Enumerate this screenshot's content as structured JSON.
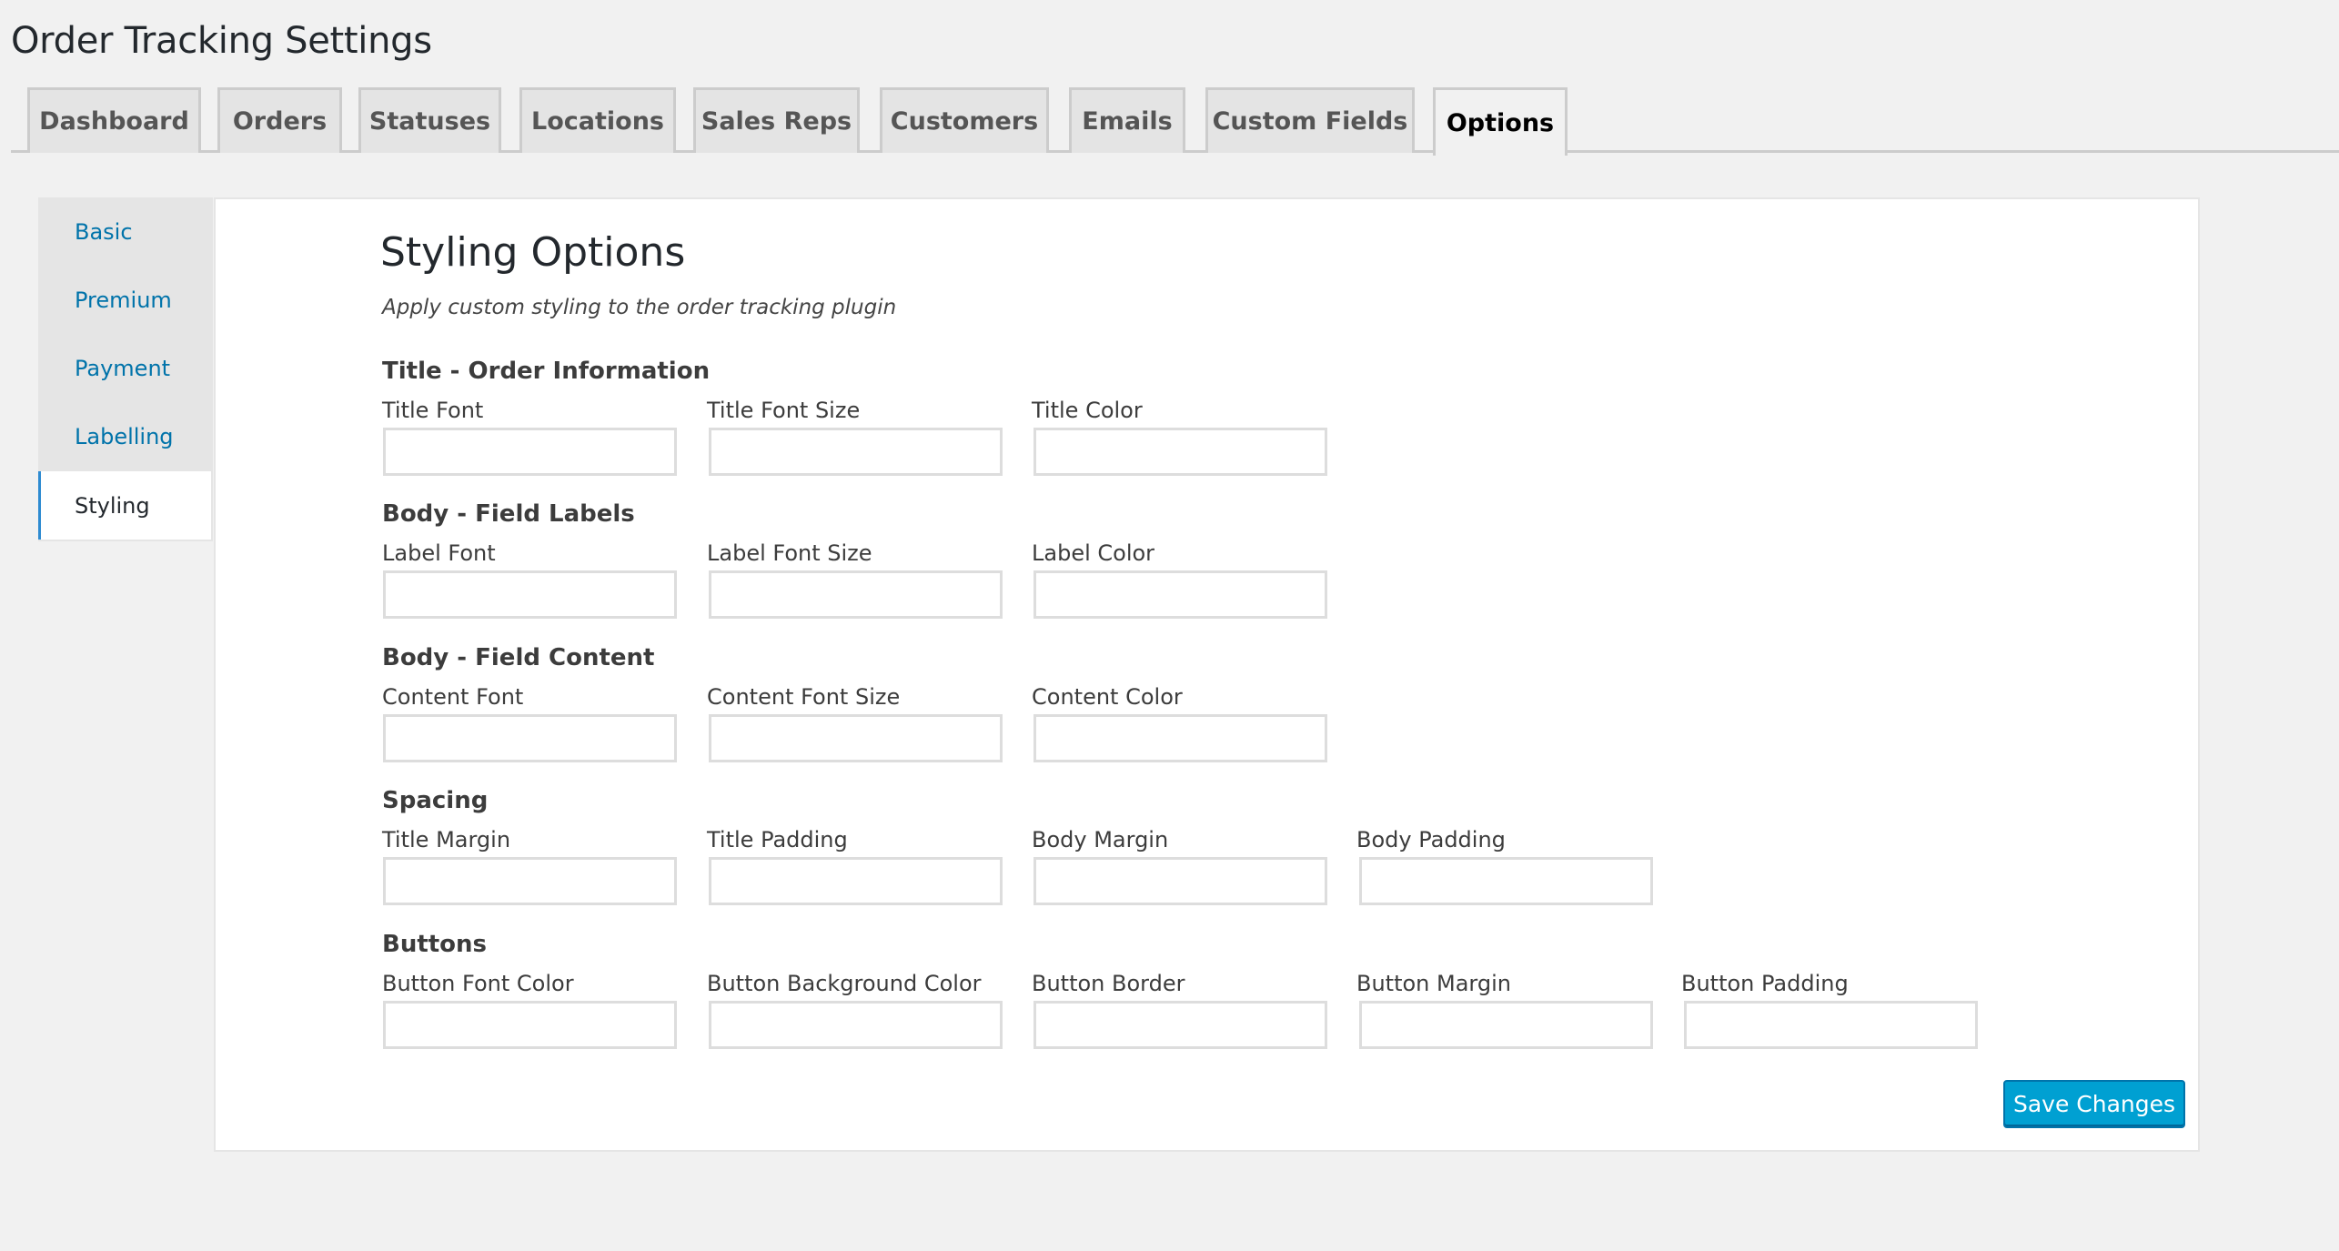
{
  "page": {
    "title": "Order Tracking Settings"
  },
  "tabs": [
    {
      "label": "Dashboard",
      "active": false
    },
    {
      "label": "Orders",
      "active": false
    },
    {
      "label": "Statuses",
      "active": false
    },
    {
      "label": "Locations",
      "active": false
    },
    {
      "label": "Sales Reps",
      "active": false
    },
    {
      "label": "Customers",
      "active": false
    },
    {
      "label": "Emails",
      "active": false
    },
    {
      "label": "Custom Fields",
      "active": false
    },
    {
      "label": "Options",
      "active": true
    }
  ],
  "sidebar": {
    "items": [
      {
        "label": "Basic",
        "active": false
      },
      {
        "label": "Premium",
        "active": false
      },
      {
        "label": "Payment",
        "active": false
      },
      {
        "label": "Labelling",
        "active": false
      },
      {
        "label": "Styling",
        "active": true
      }
    ]
  },
  "main": {
    "title": "Styling Options",
    "description": "Apply custom styling to the order tracking plugin",
    "groups": [
      {
        "label": "Title - Order Information",
        "fields": [
          {
            "label": "Title Font",
            "value": ""
          },
          {
            "label": "Title Font Size",
            "value": ""
          },
          {
            "label": "Title Color",
            "value": ""
          }
        ]
      },
      {
        "label": "Body - Field Labels",
        "fields": [
          {
            "label": "Label Font",
            "value": ""
          },
          {
            "label": "Label Font Size",
            "value": ""
          },
          {
            "label": "Label Color",
            "value": ""
          }
        ]
      },
      {
        "label": "Body - Field Content",
        "fields": [
          {
            "label": "Content Font",
            "value": ""
          },
          {
            "label": "Content Font Size",
            "value": ""
          },
          {
            "label": "Content Color",
            "value": ""
          }
        ]
      },
      {
        "label": "Spacing",
        "fields": [
          {
            "label": "Title Margin",
            "value": ""
          },
          {
            "label": "Title Padding",
            "value": ""
          },
          {
            "label": "Body Margin",
            "value": ""
          },
          {
            "label": "Body Padding",
            "value": ""
          }
        ]
      },
      {
        "label": "Buttons",
        "fields": [
          {
            "label": "Button Font Color",
            "value": ""
          },
          {
            "label": "Button Background Color",
            "value": ""
          },
          {
            "label": "Button Border",
            "value": ""
          },
          {
            "label": "Button Margin",
            "value": ""
          },
          {
            "label": "Button Padding",
            "value": ""
          }
        ]
      }
    ],
    "save_label": "Save Changes"
  },
  "colors": {
    "accent": "#0073aa",
    "button_bg": "#00a0d2",
    "active_indicator": "#2e8bd1",
    "page_bg": "#f1f1f1"
  }
}
